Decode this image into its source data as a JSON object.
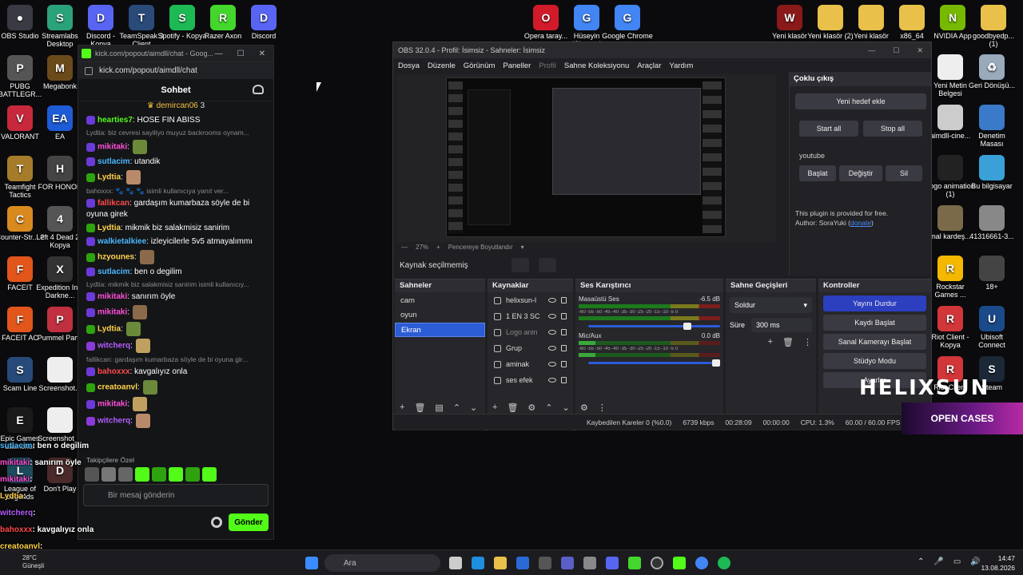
{
  "desktop_left_col1": [
    {
      "label": "OBS Studio",
      "color": "#3a3a44",
      "glyph": "●"
    },
    {
      "label": "PUBG BATTLEGR...",
      "color": "#555",
      "glyph": "P"
    },
    {
      "label": "VALORANT",
      "color": "#c8283c",
      "glyph": "V"
    },
    {
      "label": "Teamfight Tactics",
      "color": "#a67c2a",
      "glyph": "T"
    },
    {
      "label": "Counter-Str... 2",
      "color": "#d98a1f",
      "glyph": "C"
    },
    {
      "label": "FACEIT",
      "color": "#e2551b",
      "glyph": "F"
    },
    {
      "label": "FACEIT AC",
      "color": "#e2551b",
      "glyph": "F"
    },
    {
      "label": "Scam Line",
      "color": "#274a7a",
      "glyph": "S"
    },
    {
      "label": "Epic Games Launcher",
      "color": "#1a1a1a",
      "glyph": "E"
    },
    {
      "label": "League of Legends",
      "color": "#1c4c5c",
      "glyph": "L"
    }
  ],
  "desktop_left_col2": [
    {
      "label": "Streamlabs Desktop",
      "color": "#2ba37a",
      "glyph": "S"
    },
    {
      "label": "Megabonk",
      "color": "#6b4a1a",
      "glyph": "M"
    },
    {
      "label": "EA",
      "color": "#1e5bd6",
      "glyph": "EA"
    },
    {
      "label": "FOR HONOR",
      "color": "#444",
      "glyph": "H"
    },
    {
      "label": "Left 4 Dead 2 - Kopya",
      "color": "#555",
      "glyph": "4"
    },
    {
      "label": "Expedition Into Darkne...",
      "color": "#333",
      "glyph": "X"
    },
    {
      "label": "Pummel Party",
      "color": "#c03040",
      "glyph": "P"
    },
    {
      "label": "Screenshot...",
      "color": "#eee",
      "glyph": ""
    },
    {
      "label": "Screenshot_1",
      "color": "#eee",
      "glyph": ""
    },
    {
      "label": "Don't Play",
      "color": "#4a2a2a",
      "glyph": "D"
    }
  ],
  "desktop_top_left": [
    {
      "label": "Discord - Kopya",
      "color": "#5865f2",
      "glyph": "D"
    },
    {
      "label": "TeamSpeak 3 Client",
      "color": "#2a4a7a",
      "glyph": "T"
    },
    {
      "label": "Spotify - Kopya",
      "color": "#1db954",
      "glyph": "S"
    },
    {
      "label": "Razer Axon",
      "color": "#44d62c",
      "glyph": "R"
    },
    {
      "label": "Discord",
      "color": "#5865f2",
      "glyph": "D"
    }
  ],
  "desktop_top_mid": [
    {
      "label": "Opera taray...",
      "color": "#d11a2a",
      "glyph": "O"
    },
    {
      "label": "Hüseyin (Chrome)",
      "color": "#4285f4",
      "glyph": "G"
    },
    {
      "label": "Google Chrome",
      "color": "#4285f4",
      "glyph": "G"
    }
  ],
  "desktop_top_right": [
    {
      "label": "Yeni klasör",
      "color": "#8a1a1a",
      "glyph": "W"
    },
    {
      "label": "Yeni klasör (2)",
      "color": "#e8c04a",
      "glyph": ""
    },
    {
      "label": "Yeni klasör",
      "color": "#e8c04a",
      "glyph": ""
    },
    {
      "label": "x86_64",
      "color": "#e8c04a",
      "glyph": ""
    },
    {
      "label": "NVIDIA App",
      "color": "#76b900",
      "glyph": "N"
    },
    {
      "label": "goodbyedp... (1)",
      "color": "#e8c04a",
      "glyph": ""
    }
  ],
  "desktop_right_col1": [
    {
      "label": "Yeni Metin Belgesi",
      "color": "#eee",
      "glyph": ""
    },
    {
      "label": "aimdll-cine...",
      "color": "#ccc",
      "glyph": ""
    },
    {
      "label": "Logo animation (1)",
      "color": "#222",
      "glyph": ""
    },
    {
      "label": "mal kardeş...",
      "color": "#7a6a4a",
      "glyph": ""
    },
    {
      "label": "Rockstar Games ...",
      "color": "#f5b800",
      "glyph": "R"
    },
    {
      "label": "Riot Client - Kopya",
      "color": "#d13639",
      "glyph": "R"
    },
    {
      "label": "Riot Client",
      "color": "#d13639",
      "glyph": "R"
    }
  ],
  "desktop_right_col2": [
    {
      "label": "Geri Dönüşü...",
      "color": "#9ab",
      "glyph": "♻"
    },
    {
      "label": "Denetim Masası",
      "color": "#3a7ac8",
      "glyph": ""
    },
    {
      "label": "Bu bilgisayar",
      "color": "#3aa0d8",
      "glyph": ""
    },
    {
      "label": "41316661-3...",
      "color": "#888",
      "glyph": ""
    },
    {
      "label": "18+",
      "color": "#444",
      "glyph": ""
    },
    {
      "label": "Ubisoft Connect",
      "color": "#1a4a8a",
      "glyph": "U"
    },
    {
      "label": "Steam",
      "color": "#1b2838",
      "glyph": "S"
    }
  ],
  "chat": {
    "window_title": "kick.com/popout/aimdll/chat - Goog...",
    "url": "kick.com/popout/aimdll/chat",
    "header": "Sohbet",
    "pinned_user": "demircan06",
    "pinned_count": "3",
    "messages": [
      {
        "reply": "",
        "user": "hearties7",
        "ucolor": "#53fc18",
        "text": ": HOSE FIN ABISS"
      },
      {
        "reply": "Lydtia: biz cevresi sayiliyo muyuz backrooms oynam...",
        "user": "",
        "ucolor": "",
        "text": ""
      },
      {
        "reply": "",
        "user": "mikitaki",
        "ucolor": "#ff4fd8",
        "text": ":"
      },
      {
        "reply": "",
        "user": "sutlacim",
        "ucolor": "#4ab8ff",
        "text": ": utandik"
      },
      {
        "reply": "",
        "user": "Lydtia",
        "ucolor": "#ffd24a",
        "text": ":"
      },
      {
        "reply": "bahoxxx: 🐾 🐾 🐾 isimli kullanıcıya yanıt ver...",
        "user": "",
        "ucolor": "",
        "text": ""
      },
      {
        "reply": "",
        "user": "fallikcan",
        "ucolor": "#ff4a4a",
        "text": ": gardaşım kumarbaza söyle de bi oyuna girek"
      },
      {
        "reply": "",
        "user": "Lydtia",
        "ucolor": "#ffd24a",
        "text": ": mikmik biz salakmisiz sanirim"
      },
      {
        "reply": "",
        "user": "walkietalkiee",
        "ucolor": "#4ab8ff",
        "text": ": izleyicilerle 5v5 atmayalımmı"
      },
      {
        "reply": "",
        "user": "hzyounes",
        "ucolor": "#ffd24a",
        "text": ":"
      },
      {
        "reply": "",
        "user": "sutlacim",
        "ucolor": "#4ab8ff",
        "text": ": ben o degilim"
      },
      {
        "reply": "Lydtia: mikmik biz salakmisiz sanirim isimli kullanıcıy...",
        "user": "",
        "ucolor": "",
        "text": ""
      },
      {
        "reply": "",
        "user": "mikitaki",
        "ucolor": "#ff4fd8",
        "text": ": sanırım öyle"
      },
      {
        "reply": "",
        "user": "mikitaki",
        "ucolor": "#ff4fd8",
        "text": ":"
      },
      {
        "reply": "",
        "user": "Lydtia",
        "ucolor": "#ffd24a",
        "text": ":"
      },
      {
        "reply": "",
        "user": "witcherq",
        "ucolor": "#b45cff",
        "text": ":"
      },
      {
        "reply": "fallikcan: gardaşım kumarbaza söyle de bi oyuna gir...",
        "user": "",
        "ucolor": "",
        "text": ""
      },
      {
        "reply": "",
        "user": "bahoxxx",
        "ucolor": "#ff4a4a",
        "text": ": kavgalıyız onla"
      },
      {
        "reply": "",
        "user": "creatoanvl",
        "ucolor": "#ffd24a",
        "text": ":"
      },
      {
        "reply": "",
        "user": "mikitaki",
        "ucolor": "#ff4fd8",
        "text": ":"
      },
      {
        "reply": "",
        "user": "witcherq",
        "ucolor": "#b45cff",
        "text": ":"
      }
    ],
    "emote_tab": "Takipçilere Özel",
    "input_placeholder": "Bir mesaj gönderin",
    "send_label": "Gönder"
  },
  "overlay_chat": [
    {
      "user": "sutlacim",
      "color": "#4ab8ff",
      "text": ": ben o degilim"
    },
    {
      "user": "mikitaki",
      "color": "#ff4fd8",
      "text": ": sanırım öyle"
    },
    {
      "user": "mikitaki",
      "color": "#ff4fd8",
      "text": ":"
    },
    {
      "user": "Lydtia",
      "color": "#ffd24a",
      "text": ":"
    },
    {
      "user": "witcherq",
      "color": "#b45cff",
      "text": ":"
    },
    {
      "user": "bahoxxx",
      "color": "#ff4a4a",
      "text": ": kavgalıyız onla"
    },
    {
      "user": "creatoanvl",
      "color": "#ffd24a",
      "text": ":"
    },
    {
      "user": "mikitaki",
      "color": "#ff4fd8",
      "text": ":"
    },
    {
      "user": "witcherq",
      "color": "#b45cff",
      "text": ":"
    }
  ],
  "obs": {
    "title": "OBS 32.0.4 - Profil: İsimsiz - Sahneler: İsimsiz",
    "menu": [
      "Dosya",
      "Düzenle",
      "Görünüm",
      "Paneller",
      "Profil",
      "Sahne Koleksiyonu",
      "Araçlar",
      "Yardım"
    ],
    "zoom": "27%",
    "resize_label": "Pencereye Boyutlandır",
    "source_status": "Kaynak seçilmemiş",
    "scenes_title": "Sahneler",
    "scenes": [
      "cam",
      "oyun",
      "Ekran"
    ],
    "selected_scene": 2,
    "sources_title": "Kaynaklar",
    "sources": [
      "helixsun-l",
      "1 EN 3 SC",
      "Logo anin",
      "Grup",
      "aminak",
      "ses efek"
    ],
    "mixer_title": "Ses Karıştırıcı",
    "mixer": [
      {
        "name": "Masaüstü Ses",
        "db": "-6.5 dB"
      },
      {
        "name": "Mic/Aux",
        "db": "0.0 dB"
      }
    ],
    "meter_ticks": "-60 -55 -50 -45 -40 -35 -30 -25 -20 -15 -10 -5 0",
    "transitions_title": "Sahne Geçişleri",
    "transition": "Soldur",
    "duration_label": "Süre",
    "duration": "300 ms",
    "controls_title": "Kontroller",
    "controls": [
      "Yayını Durdur",
      "Kaydı Başlat",
      "Sanal Kamerayı Başlat",
      "Stüdyo Modu",
      "Ayarlar"
    ],
    "status": {
      "dropped": "Kaybedilen Kareler 0 (%0.0)",
      "kbps": "6739 kbps",
      "live_time": "00:28:09",
      "rec_time": "00:00:00",
      "cpu": "CPU: 1.3%",
      "fps": "60.00 / 60.00 FPS"
    }
  },
  "multi": {
    "title": "Çoklu çıkış",
    "add": "Yeni hedef ekle",
    "start_all": "Start all",
    "stop_all": "Stop all",
    "target": "youtube",
    "start": "Başlat",
    "edit": "Değiştir",
    "delete": "Sil",
    "note": "This plugin is provided for free.",
    "author_prefix": "Author: SoraYuki (",
    "donate": "donate",
    "author_suffix": ")"
  },
  "overlay": {
    "brand": "HELIXSUN",
    "open_cases": "OPEN CASES"
  },
  "taskbar": {
    "search": "Ara",
    "weather_temp": "28°C",
    "weather_desc": "Güneşli",
    "time": "14:47",
    "date": "13.08.2026"
  }
}
